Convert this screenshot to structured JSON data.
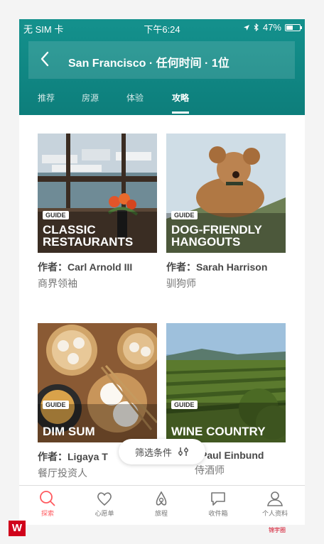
{
  "status_bar": {
    "carrier": "无 SIM 卡",
    "time": "下午6:24",
    "battery": "47%"
  },
  "search": {
    "query": "San Francisco · 任何时间 · 1位"
  },
  "tabs": [
    "推荐",
    "房源",
    "体验",
    "攻略"
  ],
  "active_tab": 3,
  "guides": [
    {
      "badge": "GUIDE",
      "title": "CLASSIC RESTAURANTS",
      "author": "作者：Carl Arnold III",
      "role": "商界领袖"
    },
    {
      "badge": "GUIDE",
      "title": "DOG-FRIENDLY HANGOUTS",
      "author": "作者：Sarah Harrison",
      "role": "驯狗师"
    },
    {
      "badge": "GUIDE",
      "title": "DIM SUM",
      "author": "作者：Ligaya T",
      "role": "餐厅投资人"
    },
    {
      "badge": "GUIDE",
      "title": "WINE COUNTRY",
      "author": "Paul Einbund",
      "role": "侍酒师"
    }
  ],
  "filter_button": {
    "label": "筛选条件"
  },
  "bottom_nav": [
    {
      "label": "探索",
      "icon": "search-icon",
      "active": true
    },
    {
      "label": "心愿单",
      "icon": "heart-icon",
      "active": false
    },
    {
      "label": "旅程",
      "icon": "airbnb-logo-icon",
      "active": false
    },
    {
      "label": "收件箱",
      "icon": "chat-icon",
      "active": false
    },
    {
      "label": "个人资料",
      "icon": "person-icon",
      "active": false
    }
  ],
  "watermark": {
    "text": "锦宇圈"
  },
  "colors": {
    "header": "#0d8a86",
    "accent": "#ff5a5f",
    "text": "#484848"
  }
}
